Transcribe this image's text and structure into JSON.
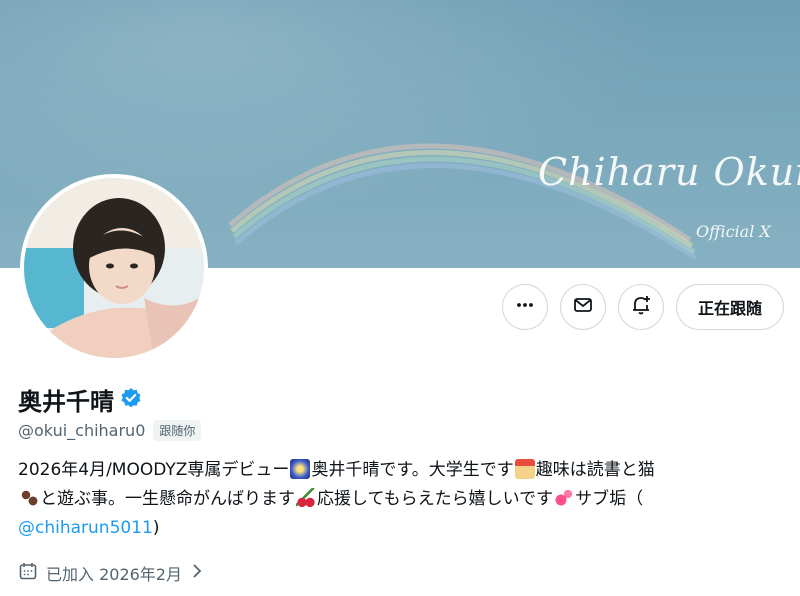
{
  "banner": {
    "signature": "Chiharu Okui",
    "signature_sub": "Official X"
  },
  "actions": {
    "more_label": "More",
    "message_label": "Message",
    "notify_label": "Notifications",
    "following_label": "正在跟随"
  },
  "profile": {
    "name": "奥井千晴",
    "handle": "@okui_chiharu0",
    "follows_you": "跟随你",
    "bio": {
      "t1": "2026年4月/MOODYZ専属デビュー",
      "t2": "奥井千晴です。大学生です",
      "t3": "趣味は読書と猫",
      "t4": "と遊ぶ事。一生懸命がんばります",
      "t5": "応援してもらえたら嬉しいです",
      "t6": "サブ垢（",
      "link": "@chiharun5011",
      "t7": ")"
    },
    "joined": "已加入 2026年2月"
  },
  "colors": {
    "accent": "#1d9bf0",
    "verified": "#1d9bf0",
    "muted_text": "#536471",
    "border": "#cfd9de"
  },
  "icons": {
    "more": "more-dots-icon",
    "message": "envelope-icon",
    "notify": "bell-plus-icon",
    "verified": "verified-badge-icon",
    "calendar": "calendar-icon",
    "chevron": "chevron-right-icon"
  }
}
